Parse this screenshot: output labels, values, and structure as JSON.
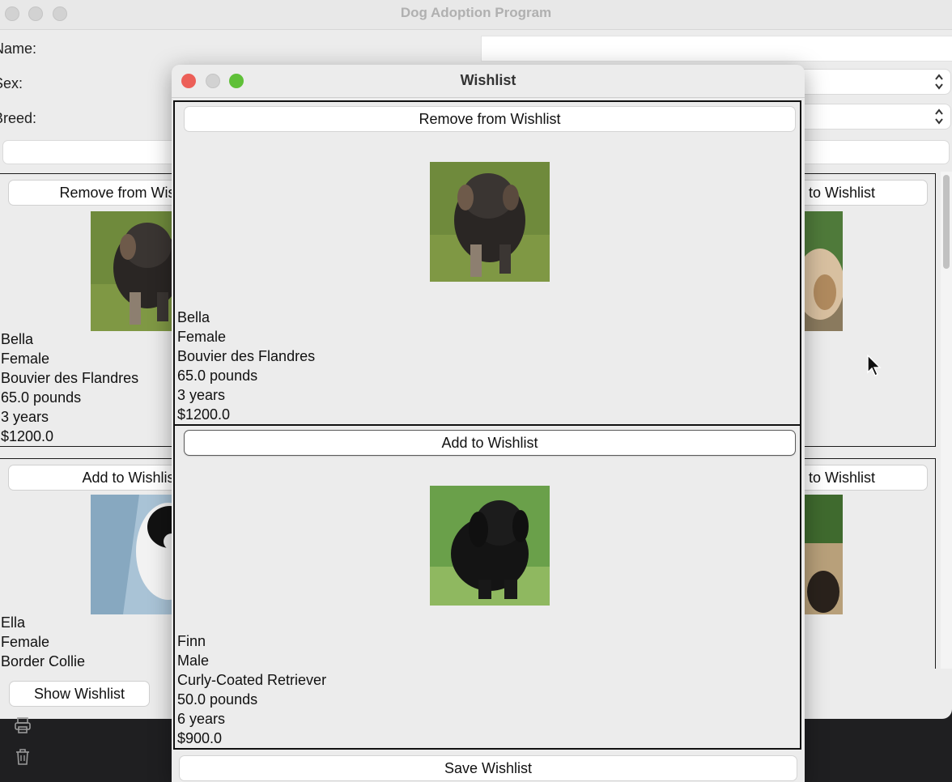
{
  "main_window": {
    "title": "Dog Adoption Program",
    "form": {
      "name_label": "Name:",
      "sex_label": "Sex:",
      "breed_label": "Breed:"
    },
    "cards": [
      {
        "button_label": "Remove from Wishlist",
        "name": "Bella",
        "sex": "Female",
        "breed": "Bouvier des Flandres",
        "weight": "65.0 pounds",
        "age": "3 years",
        "price": "$1200.0"
      },
      {
        "button_label": "Add to Wishlist",
        "name": "Ella",
        "sex": "Female",
        "breed": "Border Collie"
      },
      {
        "button_label": "Add to Wishlist"
      },
      {
        "button_label": "Add to Wishlist"
      }
    ],
    "show_wishlist_label": "Show Wishlist"
  },
  "wishlist_window": {
    "title": "Wishlist",
    "items": [
      {
        "button_label": "Remove from Wishlist",
        "name": "Bella",
        "sex": "Female",
        "breed": "Bouvier des Flandres",
        "weight": "65.0 pounds",
        "age": "3 years",
        "price": "$1200.0"
      },
      {
        "button_label": "Add to Wishlist",
        "name": "Finn",
        "sex": "Male",
        "breed": "Curly-Coated Retriever",
        "weight": "50.0 pounds",
        "age": "6 years",
        "price": "$900.0"
      }
    ],
    "save_label": "Save Wishlist"
  },
  "colors": {
    "close": "#ec5f58",
    "minimize": "#d6d6d6",
    "zoom": "#5fc038",
    "window_bg": "#ececec"
  },
  "icons": [
    "print-icon",
    "trash-icon",
    "chevron-up-down-icon",
    "pointer-cursor-icon"
  ]
}
